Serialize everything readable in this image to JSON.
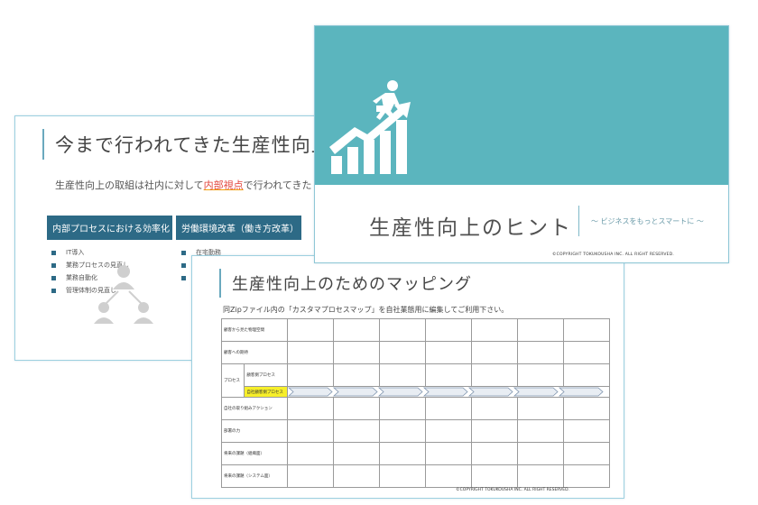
{
  "slide1": {
    "title": "今まで行われてきた生産性向上の取",
    "intro_before": "生産性向上の取組は社内に対して",
    "intro_highlight": "内部視点",
    "intro_after": "で行われてきた",
    "header_left": "内部プロセスにおける効率化",
    "header_right": "労働環境改革（働き方改革）",
    "bullets_left": [
      "IT導入",
      "業務プロセスの見直し",
      "業務自動化",
      "管理体制の見直し"
    ],
    "bullets_right": [
      "在宅勤務",
      "",
      ""
    ]
  },
  "slide2": {
    "title": "生産性向上のヒント",
    "subtitle": "～ ビジネスをもっとスマートに ～",
    "copyright": "©COPYRIGHT TOKUKOUSHA INC. ALL RIGHT RESERVED."
  },
  "slide3": {
    "title": "生産性向上のためのマッピング",
    "note": "同Zipファイル内の「カスタマプロセスマップ」を自社業態用に編集してご利用下さい。",
    "rows": {
      "r1": "顧客から見た物理空間",
      "r2": "顧客への期待",
      "r3_group": "プロセス",
      "r3_a": "顧客側プロセス",
      "r3_b": "自社顧客側プロセス",
      "r4": "自社の取り組みアクション",
      "r5": "部署の力",
      "r6": "将来の課題（組織面）",
      "r7": "将来の課題（システム面）"
    },
    "copyright": "©COPYRIGHT TOKUKOUSHA INC. ALL RIGHT RESERVED."
  },
  "colors": {
    "teal": "#5bb5be",
    "navy_header": "#2d6a86",
    "highlight": "#f7ef2a",
    "accent_red": "#e2433b"
  }
}
